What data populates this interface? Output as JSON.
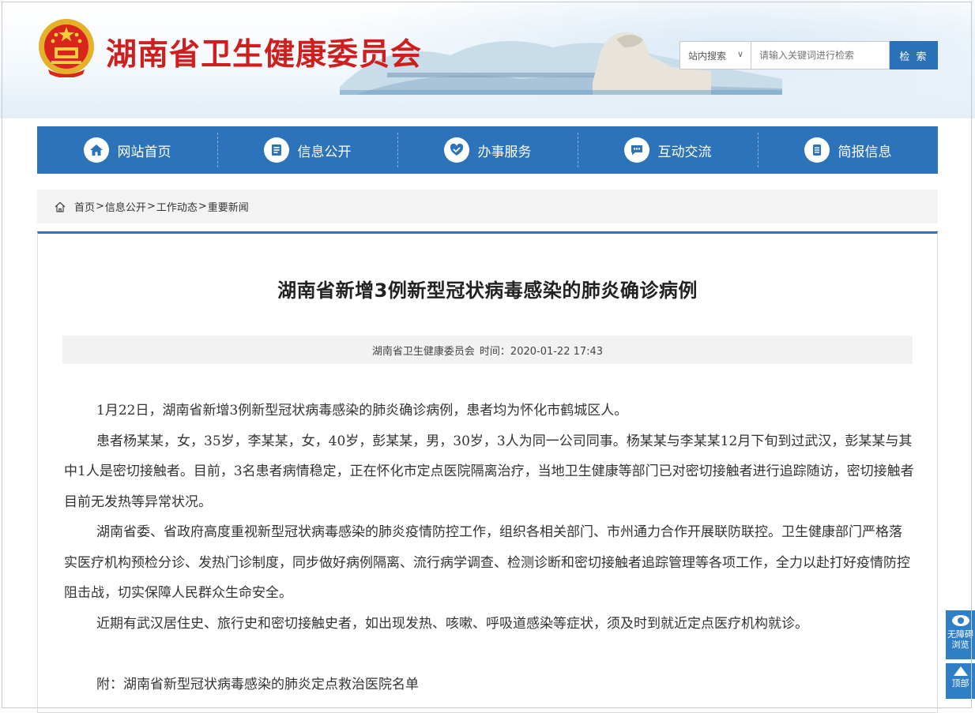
{
  "header": {
    "site_title": "湖南省卫生健康委员会",
    "search": {
      "scope_label": "站内搜索",
      "placeholder": "请输入关键词进行检索",
      "button_label": "检 索"
    }
  },
  "nav": {
    "items": [
      {
        "label": "网站首页",
        "icon": "home-icon"
      },
      {
        "label": "信息公开",
        "icon": "document-icon"
      },
      {
        "label": "办事服务",
        "icon": "service-icon"
      },
      {
        "label": "互动交流",
        "icon": "chat-icon"
      },
      {
        "label": "简报信息",
        "icon": "briefing-icon"
      }
    ]
  },
  "breadcrumb": {
    "items": [
      "首页",
      "信息公开",
      "工作动态",
      "重要新闻"
    ],
    "separator": ">"
  },
  "article": {
    "title": "湖南省新增3例新型冠状病毒感染的肺炎确诊病例",
    "source": "湖南省卫生健康委员会",
    "time_label": "时间：2020-01-22 17:43",
    "paragraphs": [
      "1月22日，湖南省新增3例新型冠状病毒感染的肺炎确诊病例，患者均为怀化市鹤城区人。",
      "患者杨某某，女，35岁，李某某，女，40岁，彭某某，男，30岁，3人为同一公司同事。杨某某与李某某12月下旬到过武汉，彭某某与其中1人是密切接触者。目前，3名患者病情稳定，正在怀化市定点医院隔离治疗，当地卫生健康等部门已对密切接触者进行追踪随访，密切接触者目前无发热等异常状况。",
      "湖南省委、省政府高度重视新型冠状病毒感染的肺炎疫情防控工作，组织各相关部门、市州通力合作开展联防联控。卫生健康部门严格落实医疗机构预检分诊、发热门诊制度，同步做好病例隔离、流行病学调查、检测诊断和密切接触者追踪管理等各项工作，全力以赴打好疫情防控阻击战，切实保障人民群众生命安全。",
      "近期有武汉居住史、旅行史和密切接触史者，如出现发热、咳嗽、呼吸道感染等症状，须及时到就近定点医疗机构就诊。"
    ],
    "attachment": "附：湖南省新型冠状病毒感染的肺炎定点救治医院名单"
  },
  "side_tools": {
    "accessibility_line1": "无障碍",
    "accessibility_line2": "浏览",
    "top_label": "顶部"
  },
  "colors": {
    "title_red": "#cf1e1e",
    "nav_blue": "#2c73ba",
    "widget_blue": "#2f7fc6"
  }
}
